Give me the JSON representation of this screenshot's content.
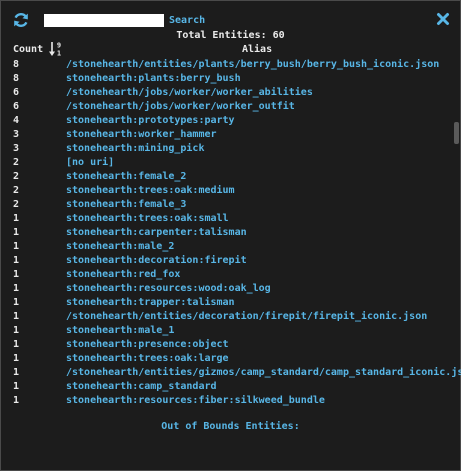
{
  "toolbar": {
    "refresh_icon": "refresh-icon",
    "search_value": "",
    "search_label": "Search",
    "close_icon": "close-icon",
    "accent": "#58b6e6"
  },
  "summary": {
    "total_label": "Total Entities: 60"
  },
  "table": {
    "columns": {
      "count": "Count",
      "alias": "Alias",
      "sort_icon": "sort-numeric-desc-icon",
      "sort_glyph_top": "9",
      "sort_glyph_bottom": "1"
    },
    "rows": [
      {
        "count": "8",
        "alias": "/stonehearth/entities/plants/berry_bush/berry_bush_iconic.json"
      },
      {
        "count": "8",
        "alias": "stonehearth:plants:berry_bush"
      },
      {
        "count": "6",
        "alias": "/stonehearth/jobs/worker/worker_abilities"
      },
      {
        "count": "6",
        "alias": "/stonehearth/jobs/worker/worker_outfit"
      },
      {
        "count": "4",
        "alias": "stonehearth:prototypes:party"
      },
      {
        "count": "3",
        "alias": "stonehearth:worker_hammer"
      },
      {
        "count": "3",
        "alias": "stonehearth:mining_pick"
      },
      {
        "count": "2",
        "alias": "[no uri]"
      },
      {
        "count": "2",
        "alias": "stonehearth:female_2"
      },
      {
        "count": "2",
        "alias": "stonehearth:trees:oak:medium"
      },
      {
        "count": "2",
        "alias": "stonehearth:female_3"
      },
      {
        "count": "1",
        "alias": "stonehearth:trees:oak:small"
      },
      {
        "count": "1",
        "alias": "stonehearth:carpenter:talisman"
      },
      {
        "count": "1",
        "alias": "stonehearth:male_2"
      },
      {
        "count": "1",
        "alias": "stonehearth:decoration:firepit"
      },
      {
        "count": "1",
        "alias": "stonehearth:red_fox"
      },
      {
        "count": "1",
        "alias": "stonehearth:resources:wood:oak_log"
      },
      {
        "count": "1",
        "alias": "stonehearth:trapper:talisman"
      },
      {
        "count": "1",
        "alias": "/stonehearth/entities/decoration/firepit/firepit_iconic.json"
      },
      {
        "count": "1",
        "alias": "stonehearth:male_1"
      },
      {
        "count": "1",
        "alias": "stonehearth:presence:object"
      },
      {
        "count": "1",
        "alias": "stonehearth:trees:oak:large"
      },
      {
        "count": "1",
        "alias": "/stonehearth/entities/gizmos/camp_standard/camp_standard_iconic.json"
      },
      {
        "count": "1",
        "alias": "stonehearth:camp_standard"
      },
      {
        "count": "1",
        "alias": "stonehearth:resources:fiber:silkweed_bundle"
      }
    ]
  },
  "out_of_bounds": {
    "label": "Out of Bounds Entities:"
  }
}
